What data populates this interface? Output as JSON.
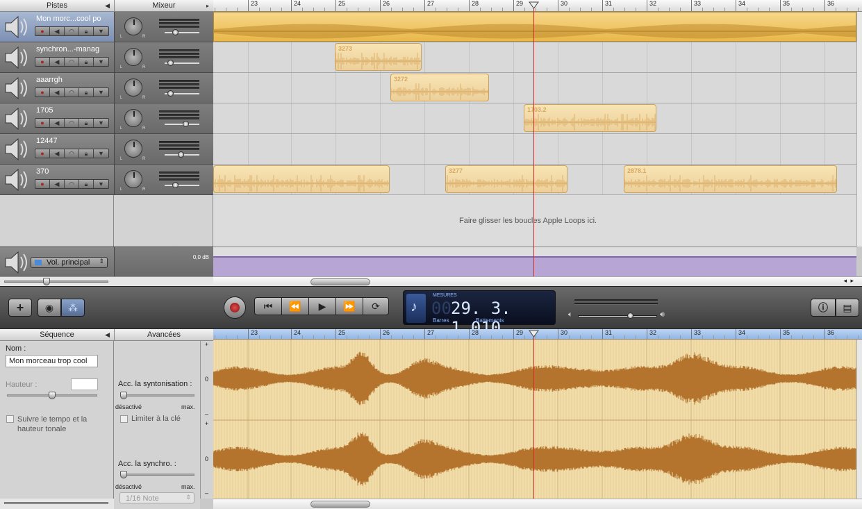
{
  "headers": {
    "tracks": "Pistes",
    "mixer": "Mixeur",
    "sequence": "Séquence",
    "advanced": "Avancées"
  },
  "ruler": {
    "bars": [
      "23",
      "24",
      "25",
      "26",
      "27",
      "28",
      "29",
      "30",
      "31",
      "32",
      "33",
      "34",
      "35",
      "36"
    ]
  },
  "tracks": [
    {
      "name": "Mon morc...cool po",
      "selected": true,
      "volume": 0.3
    },
    {
      "name": "synchron...-manag",
      "selected": false,
      "volume": 0.15
    },
    {
      "name": "aaarrgh",
      "selected": false,
      "volume": 0.15
    },
    {
      "name": "1705",
      "selected": false,
      "volume": 0.6
    },
    {
      "name": "12447",
      "selected": false,
      "volume": 0.45
    },
    {
      "name": "370",
      "selected": false,
      "volume": 0.3
    }
  ],
  "regions": [
    {
      "track": 1,
      "label": "3273"
    },
    {
      "track": 2,
      "label": "3272"
    },
    {
      "track": 3,
      "label": "1703.2"
    },
    {
      "track": 5,
      "label": ""
    },
    {
      "track": 5,
      "label": "3277"
    },
    {
      "track": 5,
      "label": "2878.1"
    }
  ],
  "drop_hint": "Faire glisser les boucles Apple Loops ici.",
  "master": {
    "label": "Vol. principal",
    "db": "0,0 dB"
  },
  "lcd": {
    "mode": "MESURES",
    "prefix": "00",
    "value": "29. 3. 1.010",
    "label_bars": "Barres",
    "label_beats": "Battements"
  },
  "editor": {
    "name_label": "Nom :",
    "name_value": "Mon morceau trop cool",
    "pitch_label": "Hauteur :",
    "follow_tempo": "Suivre le tempo et la hauteur tonale",
    "tuning_label": "Acc. la syntonisation :",
    "off": "désactivé",
    "max": "max.",
    "limit_key": "Limiter à la clé",
    "sync_label": "Acc. la synchro. :",
    "note_select": "1/16 Note",
    "axis": [
      "+",
      "0",
      "–",
      "+",
      "0",
      "–"
    ]
  },
  "colors": {
    "accent": "#d42b2b",
    "region": "#ecd09a",
    "waveform": "#b4742e",
    "master_lane": "#b7a6d4"
  }
}
